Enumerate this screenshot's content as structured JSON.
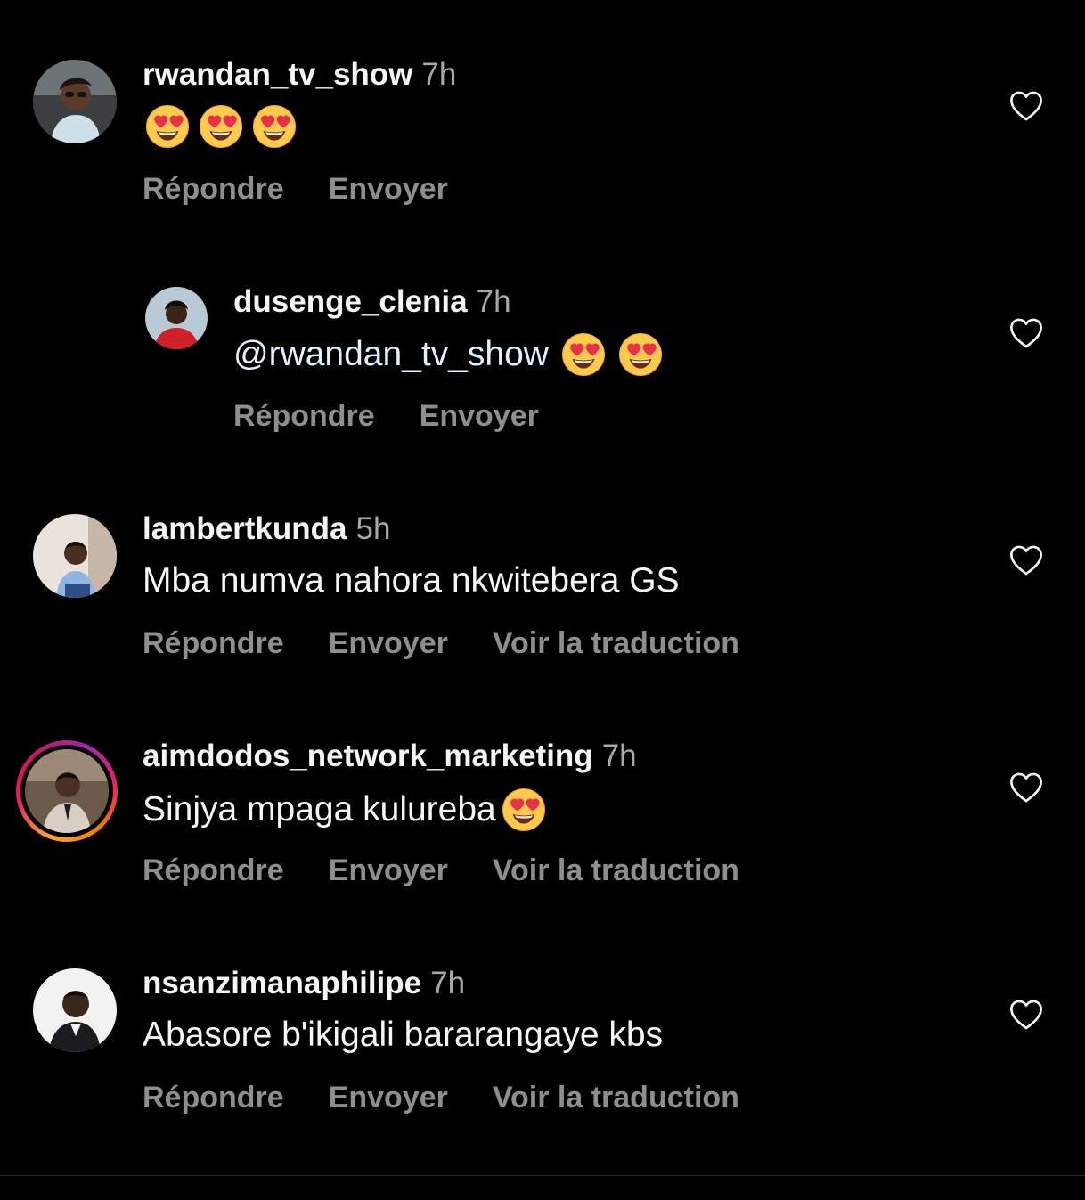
{
  "colors": {
    "background": "#000000",
    "username": "#f5f5f5",
    "timestamp": "#a8a8a8",
    "action": "#8e8e8e",
    "mention": "#e0f1ff"
  },
  "comments": [
    {
      "username": "rwandan_tv_show",
      "time": "7h",
      "emoji_count": 3,
      "emoji": "smiling-face-with-heart-eyes",
      "actions": {
        "reply": "Répondre",
        "send": "Envoyer"
      },
      "like_icon": "heart-outline-icon"
    },
    {
      "username": "dusenge_clenia",
      "time": "7h",
      "mention": "@rwandan_tv_show",
      "emoji_count": 2,
      "emoji": "smiling-face-with-heart-eyes",
      "actions": {
        "reply": "Répondre",
        "send": "Envoyer"
      },
      "like_icon": "heart-outline-icon"
    },
    {
      "username": "lambertkunda",
      "time": "5h",
      "text": "Mba numva nahora nkwitebera GS",
      "actions": {
        "reply": "Répondre",
        "send": "Envoyer",
        "translate": "Voir la traduction"
      },
      "like_icon": "heart-outline-icon"
    },
    {
      "username": "aimdodos_network_marketing",
      "time": "7h",
      "text": "Sinjya mpaga kulureba",
      "emoji": "smiling-face-with-heart-eyes",
      "has_story_ring": true,
      "actions": {
        "reply": "Répondre",
        "send": "Envoyer",
        "translate": "Voir la traduction"
      },
      "like_icon": "heart-outline-icon"
    },
    {
      "username": "nsanzimanaphilipe",
      "time": "7h",
      "text": "Abasore b'ikigali bararangaye kbs",
      "actions": {
        "reply": "Répondre",
        "send": "Envoyer",
        "translate": "Voir la traduction"
      },
      "like_icon": "heart-outline-icon"
    }
  ]
}
